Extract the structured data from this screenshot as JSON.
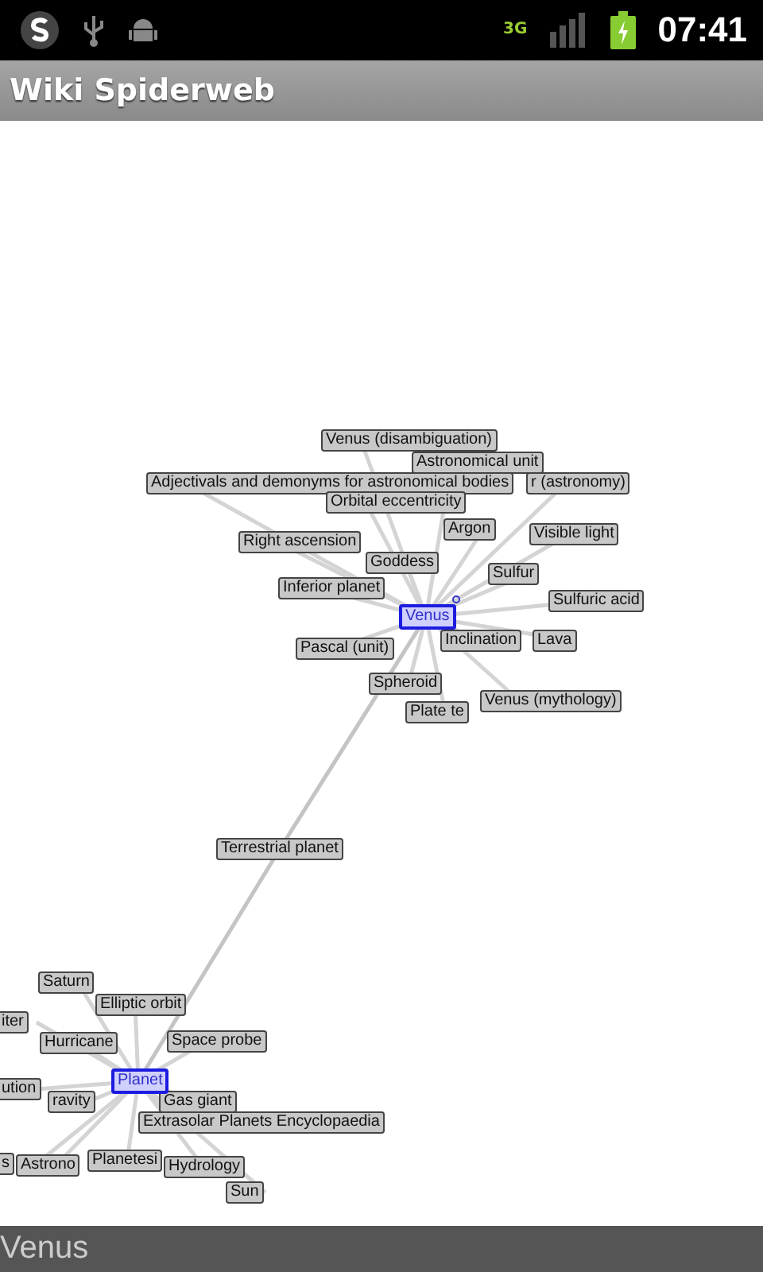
{
  "status_bar": {
    "network": "3G",
    "time": "07:41"
  },
  "app_bar": {
    "title": "Wiki Spiderweb"
  },
  "graph": {
    "hubs": [
      {
        "label": "Venus",
        "selected": true,
        "neighbors": [
          "Venus (disambiguation)",
          "Astronomical unit",
          "Adjectivals and demonyms for astronomical bodies",
          "r (astronomy)",
          "Orbital eccentricity",
          "Argon",
          "Visible light",
          "Right ascension",
          "Goddess",
          "Sulfur",
          "Inferior planet",
          "Sulfuric acid",
          "Inclination",
          "Lava",
          "Pascal (unit)",
          "Spheroid",
          "Plate te",
          "Venus (mythology)"
        ]
      },
      {
        "label": "Planet",
        "selected": true,
        "neighbors": [
          "Saturn",
          "Elliptic orbit",
          "iter",
          "Hurricane",
          "Space probe",
          "ravity",
          "ution",
          "Gas giant",
          "Extrasolar Planets Encyclopaedia",
          "s",
          "Astrono",
          "Planetesi",
          "Hydrology",
          "Sun"
        ]
      }
    ],
    "bridge": {
      "label": "Terrestrial planet"
    }
  },
  "footer": {
    "text": "Venus"
  }
}
